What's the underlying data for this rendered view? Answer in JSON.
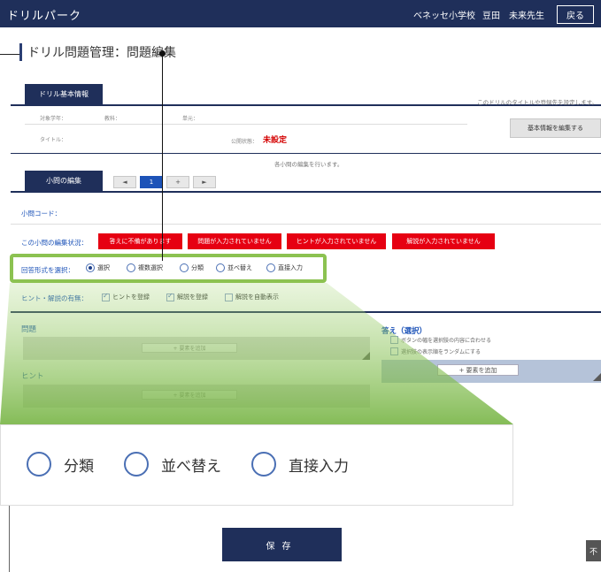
{
  "app": {
    "brand": "ドリルパーク"
  },
  "topbar": {
    "school": "ベネッセ小学校",
    "teacher": "豆田　未来先生",
    "back_label": "戻る"
  },
  "page_title": "ドリル問題管理：問題編集",
  "basic_info": {
    "tab_label": "ドリル基本情報",
    "note": "このドリルのタイトルや登録先を設定します。",
    "target_grade_label": "対象学年：",
    "subject_label": "教科：",
    "unit_label": "単元：",
    "title_label": "タイトル：",
    "status_label": "公開状態：",
    "status_value": "未設定",
    "edit_button": "基本情報を編集する"
  },
  "subquestion": {
    "tab_label": "小問の編集",
    "note": "各小問の編集を行います。",
    "pager": {
      "prev": "◄",
      "current": "1",
      "add": "+",
      "next": "►"
    }
  },
  "rows": {
    "code_label": "小問コード：",
    "status_label": "この小問の編集状況：",
    "status_tags": [
      "答えに不備があります",
      "問題が入力されていません",
      "ヒントが入力されていません",
      "解説が入力されていません"
    ],
    "answer_format_label": "回答形式を選択：",
    "answer_formats": [
      "選択",
      "複数選択",
      "分類",
      "並べ替え",
      "直接入力"
    ],
    "hint_label": "ヒント・解説の有無：",
    "hint_options": [
      "ヒントを登録",
      "解説を登録",
      "解説を自動表示"
    ]
  },
  "question": {
    "label": "問題",
    "add_label": "+ 要素を追加"
  },
  "hint": {
    "label": "ヒント",
    "add_label": "+ 要素を追加"
  },
  "answer": {
    "label": "答え（選択）",
    "options": [
      "ボタンの幅を選択肢の内容に合わせる",
      "選択肢の表示順をランダムにする"
    ],
    "add_label": "+ 要素を追加"
  },
  "zoom": {
    "options": [
      "分類",
      "並べ替え",
      "直接入力"
    ]
  },
  "save_label": "保存",
  "corner_label": "不",
  "colors": {
    "navy": "#1f2f5a",
    "accent_blue": "#1d53b8",
    "red": "#e60012",
    "green": "#8cc251"
  }
}
